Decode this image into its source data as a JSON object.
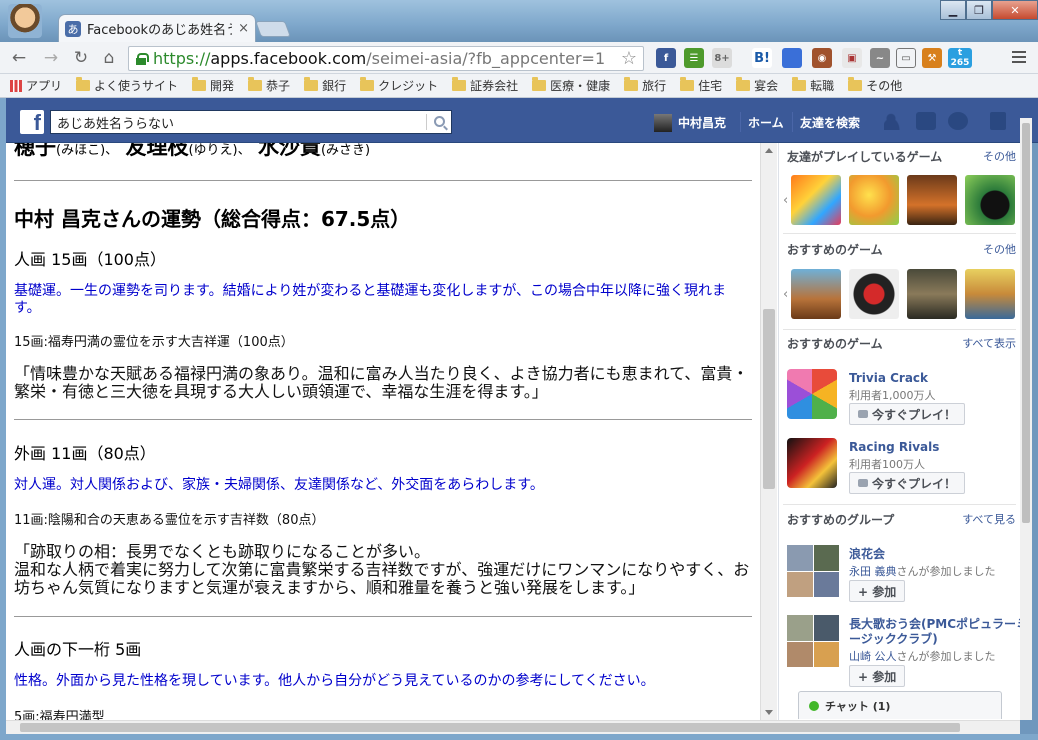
{
  "browser": {
    "tab_title": "Facebookのあじあ姓名う",
    "tab_close": "×",
    "url_scheme": "https://",
    "url_host": "apps.facebook.com",
    "url_path": "/seimei-asia/?fb_appcenter=1",
    "bookmarks": [
      "アプリ",
      "よく使うサイト",
      "開発",
      "恭子",
      "銀行",
      "クレジット",
      "証券会社",
      "医療・健康",
      "旅行",
      "住宅",
      "宴会",
      "転職",
      "その他"
    ],
    "ext_badge": "265"
  },
  "facebook": {
    "logo": "f",
    "search_value": "あじあ姓名うらない",
    "user_name": "中村昌克",
    "nav_home": "ホーム",
    "nav_friends": "友達を検索"
  },
  "main": {
    "names": [
      {
        "name": "穂子",
        "yomi": "(みほこ)、"
      },
      {
        "name": "友理枝",
        "yomi": "(ゆりえ)、"
      },
      {
        "name": "水沙貴",
        "yomi": "(みさき)"
      }
    ],
    "fortune_heading": "中村 昌克さんの運勢（総合得点：67.5点）",
    "sections": [
      {
        "heading": "人画 15画（100点）",
        "blue": "基礎運。一生の運勢を司ります。結婚により姓が変わると基礎運も変化しますが、この場合中年以降に強く現れます。",
        "small": "15画:福寿円満の霊位を示す大吉祥運（100点）",
        "quote": "「情味豊かな天賦ある福禄円満の象あり。温和に富み人当たり良く、よき協力者にも恵まれて、富貴・繁栄・有徳と三大徳を具現する大人しい頭領運で、幸福な生涯を得ます。」"
      },
      {
        "heading": "外画 11画（80点）",
        "blue": "対人運。対人関係および、家族・夫婦関係、友達関係など、外交面をあらわします。",
        "small": "11画:陰陽和合の天恵ある霊位を示す吉祥数（80点）",
        "quote": "「跡取りの相：長男でなくとも跡取りになることが多い。\n温和な人柄で着実に努力して次第に富貴繁栄する吉祥数ですが、強運だけにワンマンになりやすく、お坊ちゃん気質になりますと気運が衰えますから、順和雅量を養うと強い発展をします。」"
      },
      {
        "heading": "人画の下一桁 5画",
        "blue": "性格。外面から見た性格を現しています。他人から自分がどう見えているのかの参考にしてください。",
        "small": "5画:福寿円満型"
      }
    ]
  },
  "sidebar": {
    "friends_games_title": "友達がプレイしているゲーム",
    "friends_games_link": "その他",
    "recommended_games_title": "おすすめのゲーム",
    "recommended_games_link": "その他",
    "recommended_games2_title": "おすすめのゲーム",
    "recommended_games2_link": "すべて表示",
    "games": [
      {
        "name": "Trivia Crack",
        "users": "利用者1,000万人",
        "button": "今すぐプレイ！"
      },
      {
        "name": "Racing Rivals",
        "users": "利用者100万人",
        "button": "今すぐプレイ！"
      }
    ],
    "groups_title": "おすすめのグループ",
    "groups_link": "すべて見る",
    "groups": [
      {
        "name": "浪花会",
        "member": "永田 義典",
        "joined": "さんが参加しました",
        "button": "+ 参加"
      },
      {
        "name": "長大歌おう会(PMCポピュラーミュ",
        "name2": "ージッククラブ)",
        "member": "山崎 公人",
        "joined": "さんが参加しました",
        "button": "+ 参加"
      }
    ],
    "chat_label": "チャット (1)"
  }
}
